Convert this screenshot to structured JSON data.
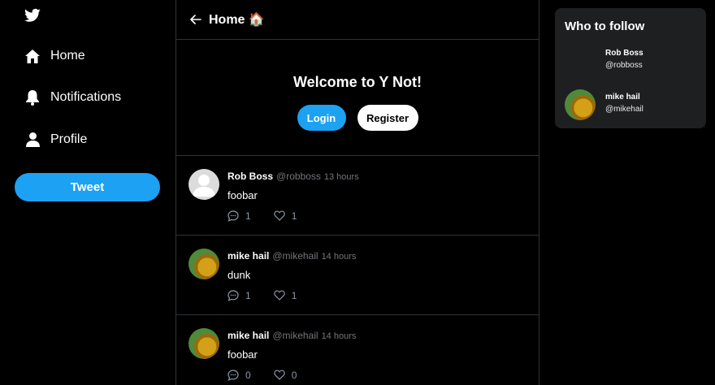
{
  "app": {
    "accent": "#1da1f2",
    "background": "#000000",
    "divider": "#2f3336"
  },
  "sidebar": {
    "logo_icon": "twitter-bird-icon",
    "items": [
      {
        "label": "Home",
        "icon": "home-icon"
      },
      {
        "label": "Notifications",
        "icon": "bell-icon"
      },
      {
        "label": "Profile",
        "icon": "user-icon"
      }
    ],
    "tweet_button": "Tweet"
  },
  "header": {
    "back_icon": "back-arrow-icon",
    "title": "Home 🏠"
  },
  "welcome": {
    "heading": "Welcome to Y Not!",
    "login_label": "Login",
    "register_label": "Register"
  },
  "tweets": [
    {
      "name": "Rob Boss",
      "handle": "@robboss",
      "time": "13 hours",
      "body": "foobar",
      "replies": "1",
      "likes": "1",
      "avatar": "default-avatar"
    },
    {
      "name": "mike hail",
      "handle": "@mikehail",
      "time": "14 hours",
      "body": "dunk",
      "replies": "1",
      "likes": "1",
      "avatar": "photo-avatar"
    },
    {
      "name": "mike hail",
      "handle": "@mikehail",
      "time": "14 hours",
      "body": "foobar",
      "replies": "0",
      "likes": "0",
      "avatar": "photo-avatar"
    }
  ],
  "who_to_follow": {
    "title": "Who to follow",
    "users": [
      {
        "name": "Rob Boss",
        "handle": "@robboss",
        "avatar": "blank-avatar"
      },
      {
        "name": "mike hail",
        "handle": "@mikehail",
        "avatar": "photo-avatar"
      }
    ]
  }
}
